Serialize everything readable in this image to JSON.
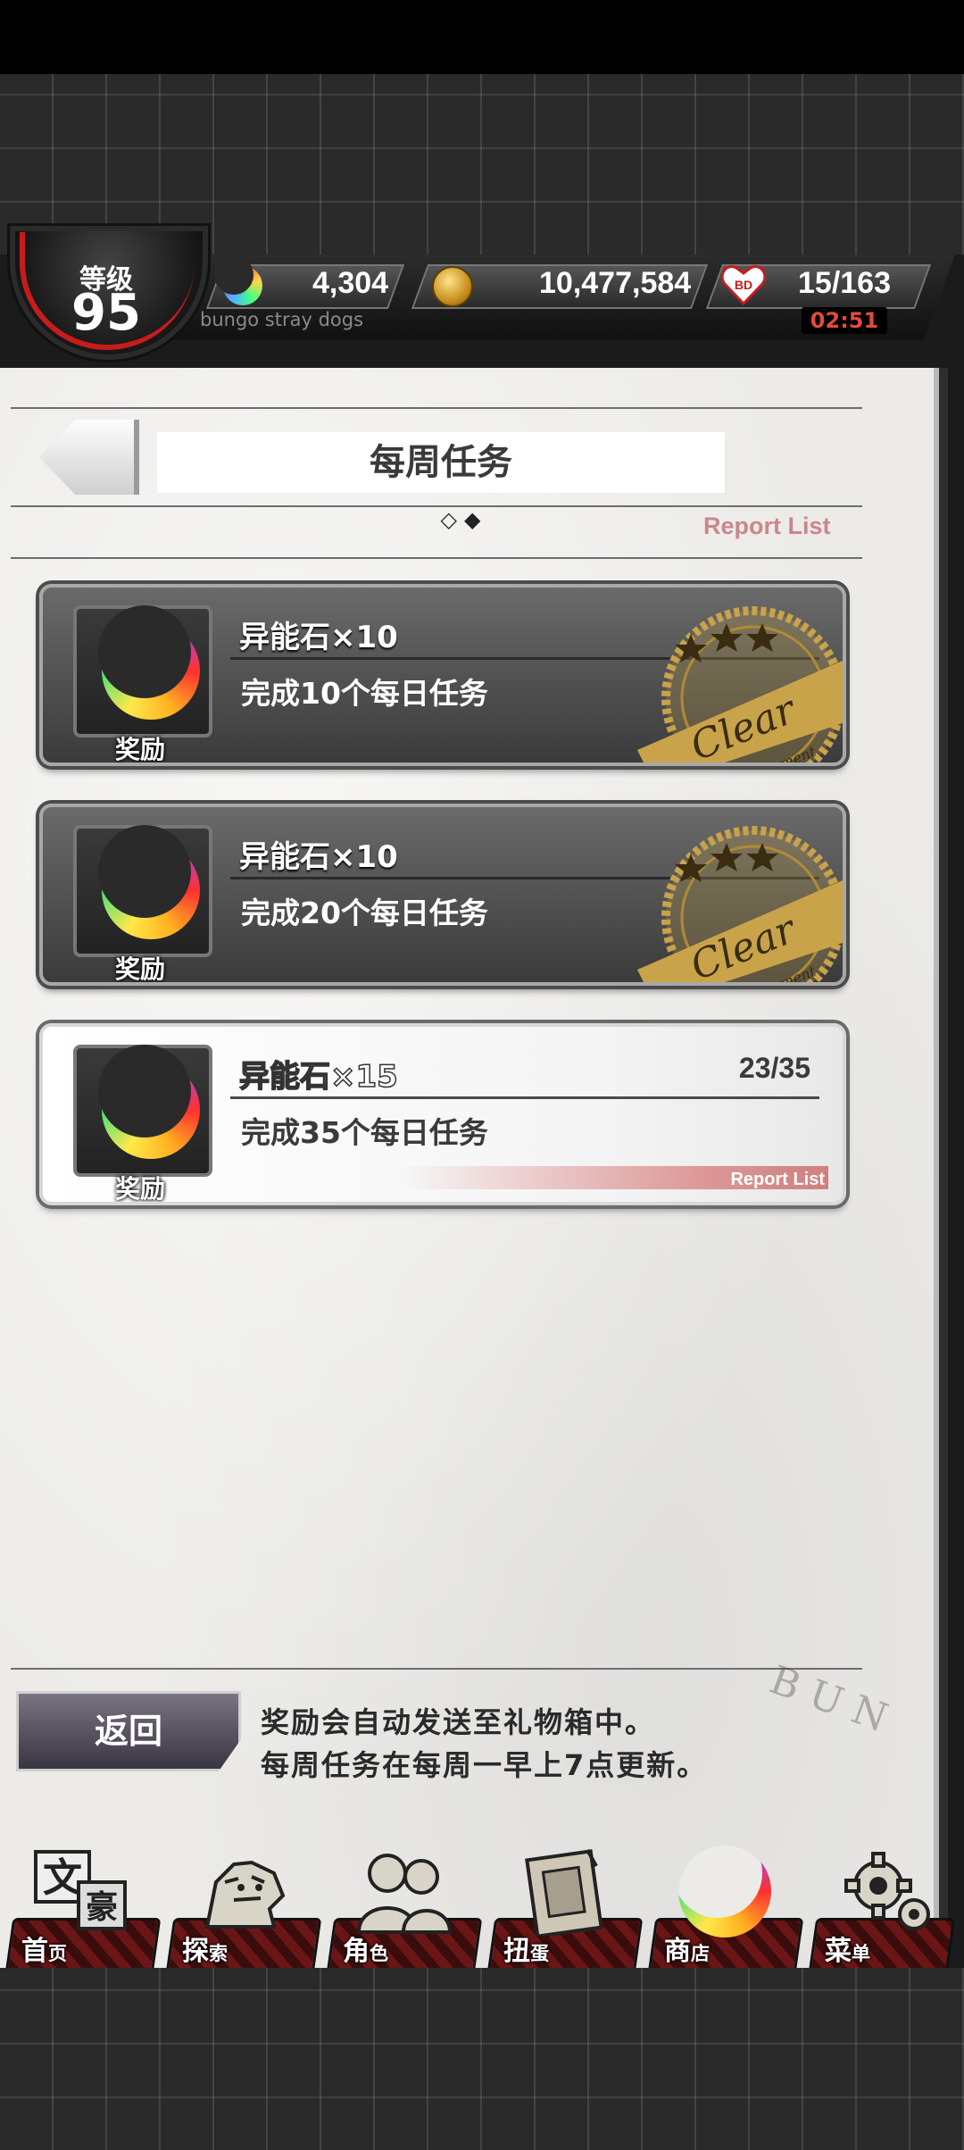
{
  "header": {
    "level_label": "等级",
    "level_value": "95",
    "stones": "4,304",
    "coins": "10,477,584",
    "stamina": "15/163",
    "subtitle": "bungo stray dogs",
    "timer": "02:51"
  },
  "page": {
    "title": "每周任务",
    "page_dots": "◇◆",
    "report_list": "Report List"
  },
  "missions": [
    {
      "reward": "异能石×10",
      "description": "完成10个每日任务",
      "reward_label": "奖励",
      "status": "clear",
      "stamp_text": "Clear",
      "stamp_sub": "Achievement"
    },
    {
      "reward": "异能石×10",
      "description": "完成20个每日任务",
      "reward_label": "奖励",
      "status": "clear",
      "stamp_text": "Clear",
      "stamp_sub": "Achievement"
    },
    {
      "reward": "异能石×15",
      "description": "完成35个每日任务",
      "reward_label": "奖励",
      "status": "in_progress",
      "progress": "23/35",
      "report_list": "Report List"
    }
  ],
  "footer": {
    "back_button": "返回",
    "notice_line1": "奖励会自动发送至礼物箱中。",
    "notice_line2": "每周任务在每周一早上7点更新。",
    "watermark": "BUN"
  },
  "nav": [
    {
      "label": "首",
      "small": "页",
      "icon": "bungo-logo-icon"
    },
    {
      "label": "探",
      "small": "索",
      "icon": "tiger-icon"
    },
    {
      "label": "角",
      "small": "色",
      "icon": "characters-icon"
    },
    {
      "label": "扭",
      "small": "蛋",
      "icon": "book-icon"
    },
    {
      "label": "商",
      "small": "店",
      "icon": "moon-stone-icon"
    },
    {
      "label": "菜",
      "small": "单",
      "icon": "gear-icon"
    }
  ],
  "colors": {
    "accent_red": "#c71c1c",
    "report_pink": "#c9878d",
    "timer_red": "#e24b3c",
    "stamp_gold": "#c9a34a"
  }
}
